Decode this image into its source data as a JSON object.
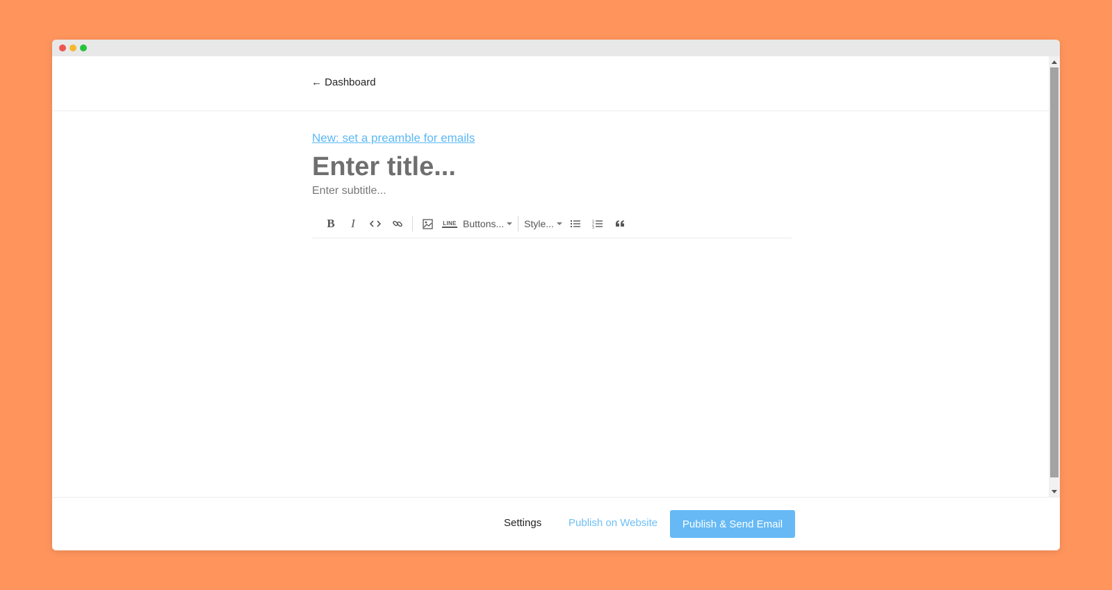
{
  "nav": {
    "back_label": "← Dashboard"
  },
  "editor": {
    "preamble_link": "New: set a preamble for emails",
    "title_placeholder": "Enter title...",
    "subtitle_placeholder": "Enter subtitle..."
  },
  "toolbar": {
    "bold": "B",
    "italic": "I",
    "line_label": "LINE",
    "buttons_dropdown": "Buttons...",
    "style_dropdown": "Style..."
  },
  "footer": {
    "settings": "Settings",
    "publish_website": "Publish on Website",
    "publish_email": "Publish & Send Email"
  },
  "colors": {
    "page_background": "#ff955d",
    "accent": "#66b9f5",
    "link": "#5bb8f5"
  }
}
